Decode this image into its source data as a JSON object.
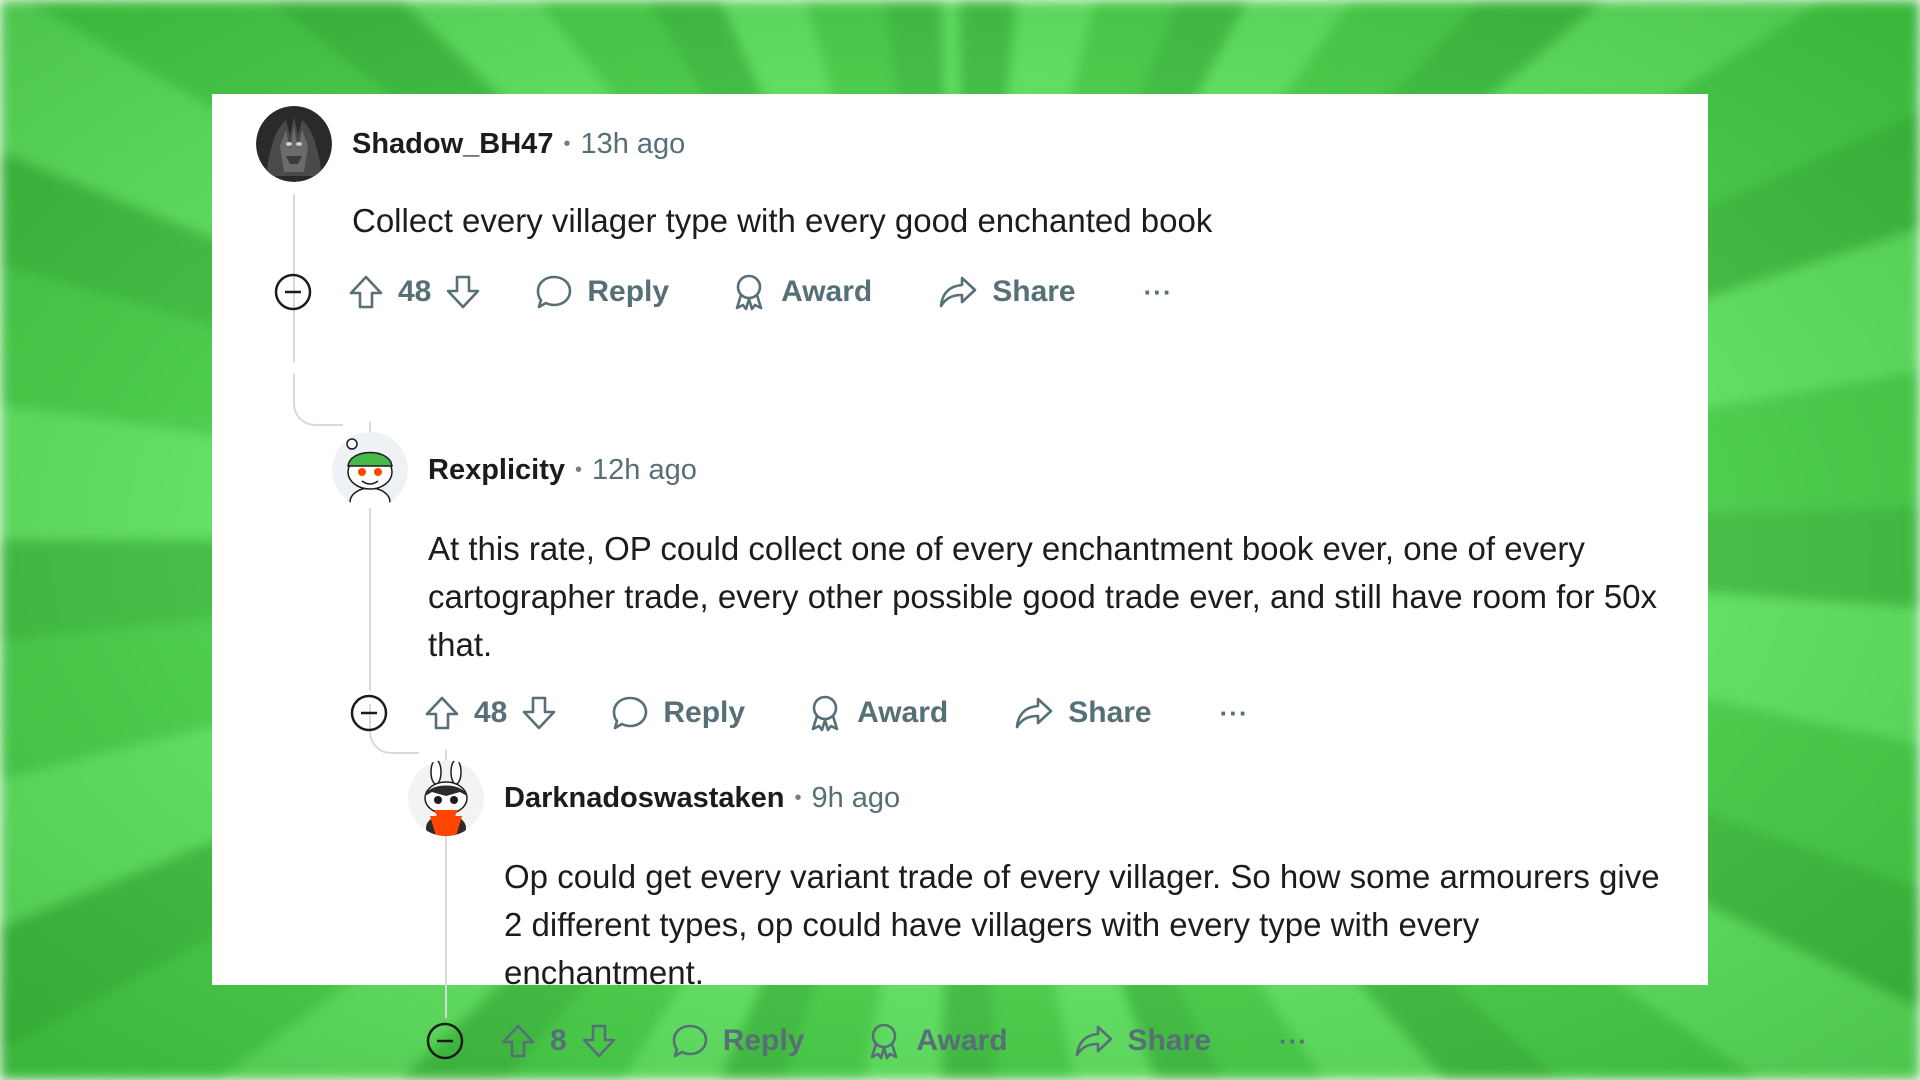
{
  "comments": [
    {
      "username": "Shadow_BH47",
      "separator": "•",
      "time": "13h ago",
      "body": "Collect every villager type with every good enchanted book",
      "score": "48",
      "actions": {
        "reply": "Reply",
        "award": "Award",
        "share": "Share",
        "more": "···"
      },
      "avatar": "dark-creature-avatar"
    },
    {
      "username": "Rexplicity",
      "separator": "•",
      "time": "12h ago",
      "body": "At this rate, OP could collect one of every enchantment book ever, one of every cartographer trade, every other possible good trade ever, and still have room for 50x that.",
      "score": "48",
      "actions": {
        "reply": "Reply",
        "award": "Award",
        "share": "Share",
        "more": "···"
      },
      "avatar": "snoo-green-hat-avatar"
    },
    {
      "username": "Darknadoswastaken",
      "separator": "•",
      "time": "9h ago",
      "body": "Op could get every variant trade of every villager. So how some armourers give 2 different types, op could have villagers with every type with every enchantment.",
      "score": "8",
      "actions": {
        "reply": "Reply",
        "award": "Award",
        "share": "Share",
        "more": "···"
      },
      "avatar": "snoo-bunny-avatar"
    }
  ],
  "colors": {
    "background": "#6fe86f",
    "card": "#ffffff",
    "text": "#1c1c1c",
    "muted": "#576f76",
    "thread_line": "#d7dadc"
  }
}
